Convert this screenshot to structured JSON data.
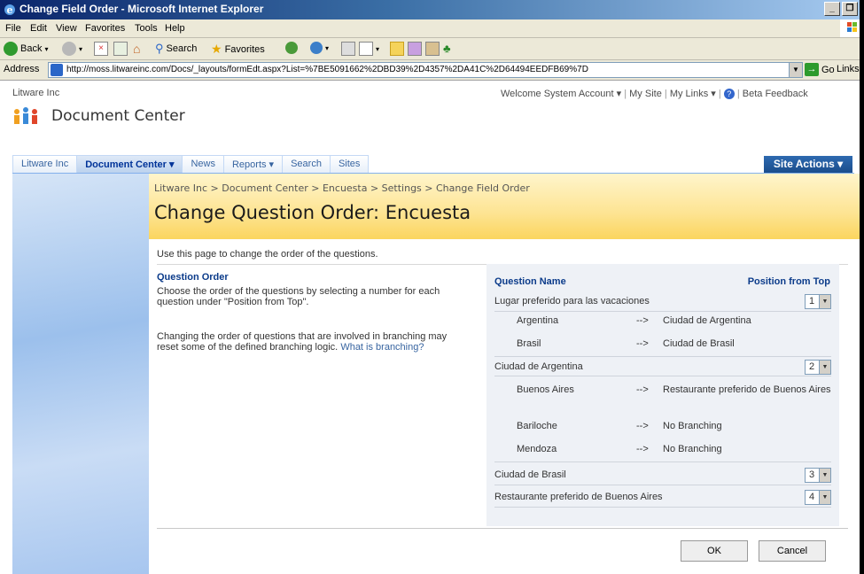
{
  "window": {
    "title": "Change Field Order - Microsoft Internet Explorer",
    "minimize": "_",
    "maximize": "❐"
  },
  "menu": [
    "File",
    "Edit",
    "View",
    "Favorites",
    "Tools",
    "Help"
  ],
  "toolbar": {
    "back": "Back",
    "search": "Search",
    "favorites": "Favorites"
  },
  "address": {
    "label": "Address",
    "url": "http://moss.litwareinc.com/Docs/_layouts/formEdt.aspx?List=%7BE5091662%2DBD39%2D4357%2DA41C%2D64494EEDFB69%7D",
    "go": "Go",
    "links": "Links"
  },
  "sharepoint": {
    "site_name": "Litware Inc",
    "welcome": "Welcome System Account ▾",
    "my_site": "My Site",
    "my_links": "My Links ▾",
    "beta_feedback": "Beta Feedback",
    "title": "Document Center",
    "site_actions": "Site Actions ▾",
    "tabs": [
      {
        "label": "Litware Inc"
      },
      {
        "label": "Document Center ▾"
      },
      {
        "label": "News"
      },
      {
        "label": "Reports ▾"
      },
      {
        "label": "Search"
      },
      {
        "label": "Sites"
      }
    ]
  },
  "page": {
    "breadcrumb": "Litware Inc > Document Center > Encuesta > Settings > Change Field Order",
    "title": "Change Question Order: Encuesta",
    "intro": "Use this page to change the order of the questions.",
    "section_title": "Question Order",
    "section_desc": "Choose the order of the questions by selecting a number for each question under \"Position from Top\".",
    "section_desc2": "Changing the order of questions that are involved in branching may reset some of the defined branching logic.",
    "branching_link": "What is branching?",
    "col_question": "Question Name",
    "col_position": "Position from Top",
    "questions": [
      {
        "name": "Lugar preferido para las vacaciones",
        "position": "1"
      },
      {
        "name": "Ciudad de Argentina",
        "position": "2"
      },
      {
        "name": "Ciudad de Brasil",
        "position": "3"
      },
      {
        "name": "Restaurante preferido de Buenos Aires",
        "position": "4"
      }
    ],
    "branches": [
      {
        "answer": "Argentina",
        "arrow": "-->",
        "target": "Ciudad de Argentina"
      },
      {
        "answer": "Brasil",
        "arrow": "-->",
        "target": "Ciudad de Brasil"
      },
      {
        "answer": "Buenos Aires",
        "arrow": "-->",
        "target": "Restaurante preferido de Buenos Aires"
      },
      {
        "answer": "Bariloche",
        "arrow": "-->",
        "target": "No Branching"
      },
      {
        "answer": "Mendoza",
        "arrow": "-->",
        "target": "No Branching"
      }
    ],
    "ok": "OK",
    "cancel": "Cancel"
  }
}
